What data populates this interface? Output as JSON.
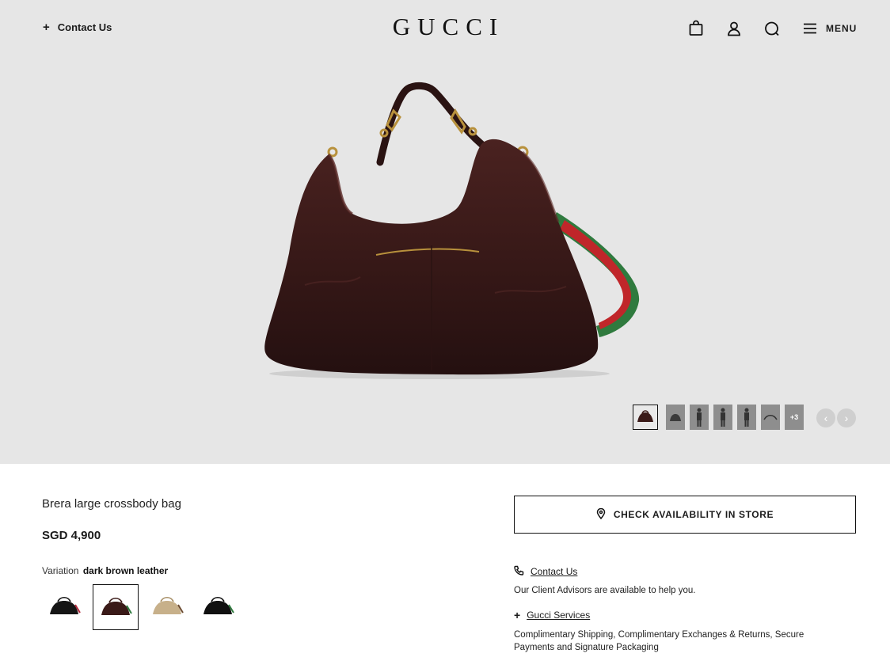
{
  "header": {
    "contact_label": "Contact Us",
    "logo": "GUCCI",
    "menu_label": "MENU",
    "icons": [
      "shopping-bag-icon",
      "account-icon",
      "search-icon",
      "hamburger-menu-icon"
    ]
  },
  "gallery": {
    "thumbnails": [
      "bag-front",
      "bag-side",
      "model-1",
      "model-2",
      "model-3",
      "strap"
    ],
    "more_label": "+3",
    "prev": "‹",
    "next": "›"
  },
  "product": {
    "title": "Brera large crossbody bag",
    "price": "SGD 4,900",
    "variation_label": "Variation",
    "variation_value": "dark brown leather",
    "swatches": [
      "black",
      "dark brown",
      "beige",
      "black"
    ]
  },
  "actions": {
    "check_store": "CHECK AVAILABILITY IN STORE"
  },
  "services": {
    "contact_label": "Contact Us",
    "contact_text": "Our Client Advisors are available to help you.",
    "gucci_services_label": "Gucci Services",
    "services_text": "Complimentary Shipping, Complimentary Exchanges & Returns, Secure Payments and Signature Packaging"
  },
  "colors": {
    "hero_bg": "#e6e6e6",
    "bag_leather": "#3a1a18",
    "strap_green": "#2f7a3e",
    "strap_red": "#c0262a",
    "hardware_gold": "#b8913c"
  }
}
